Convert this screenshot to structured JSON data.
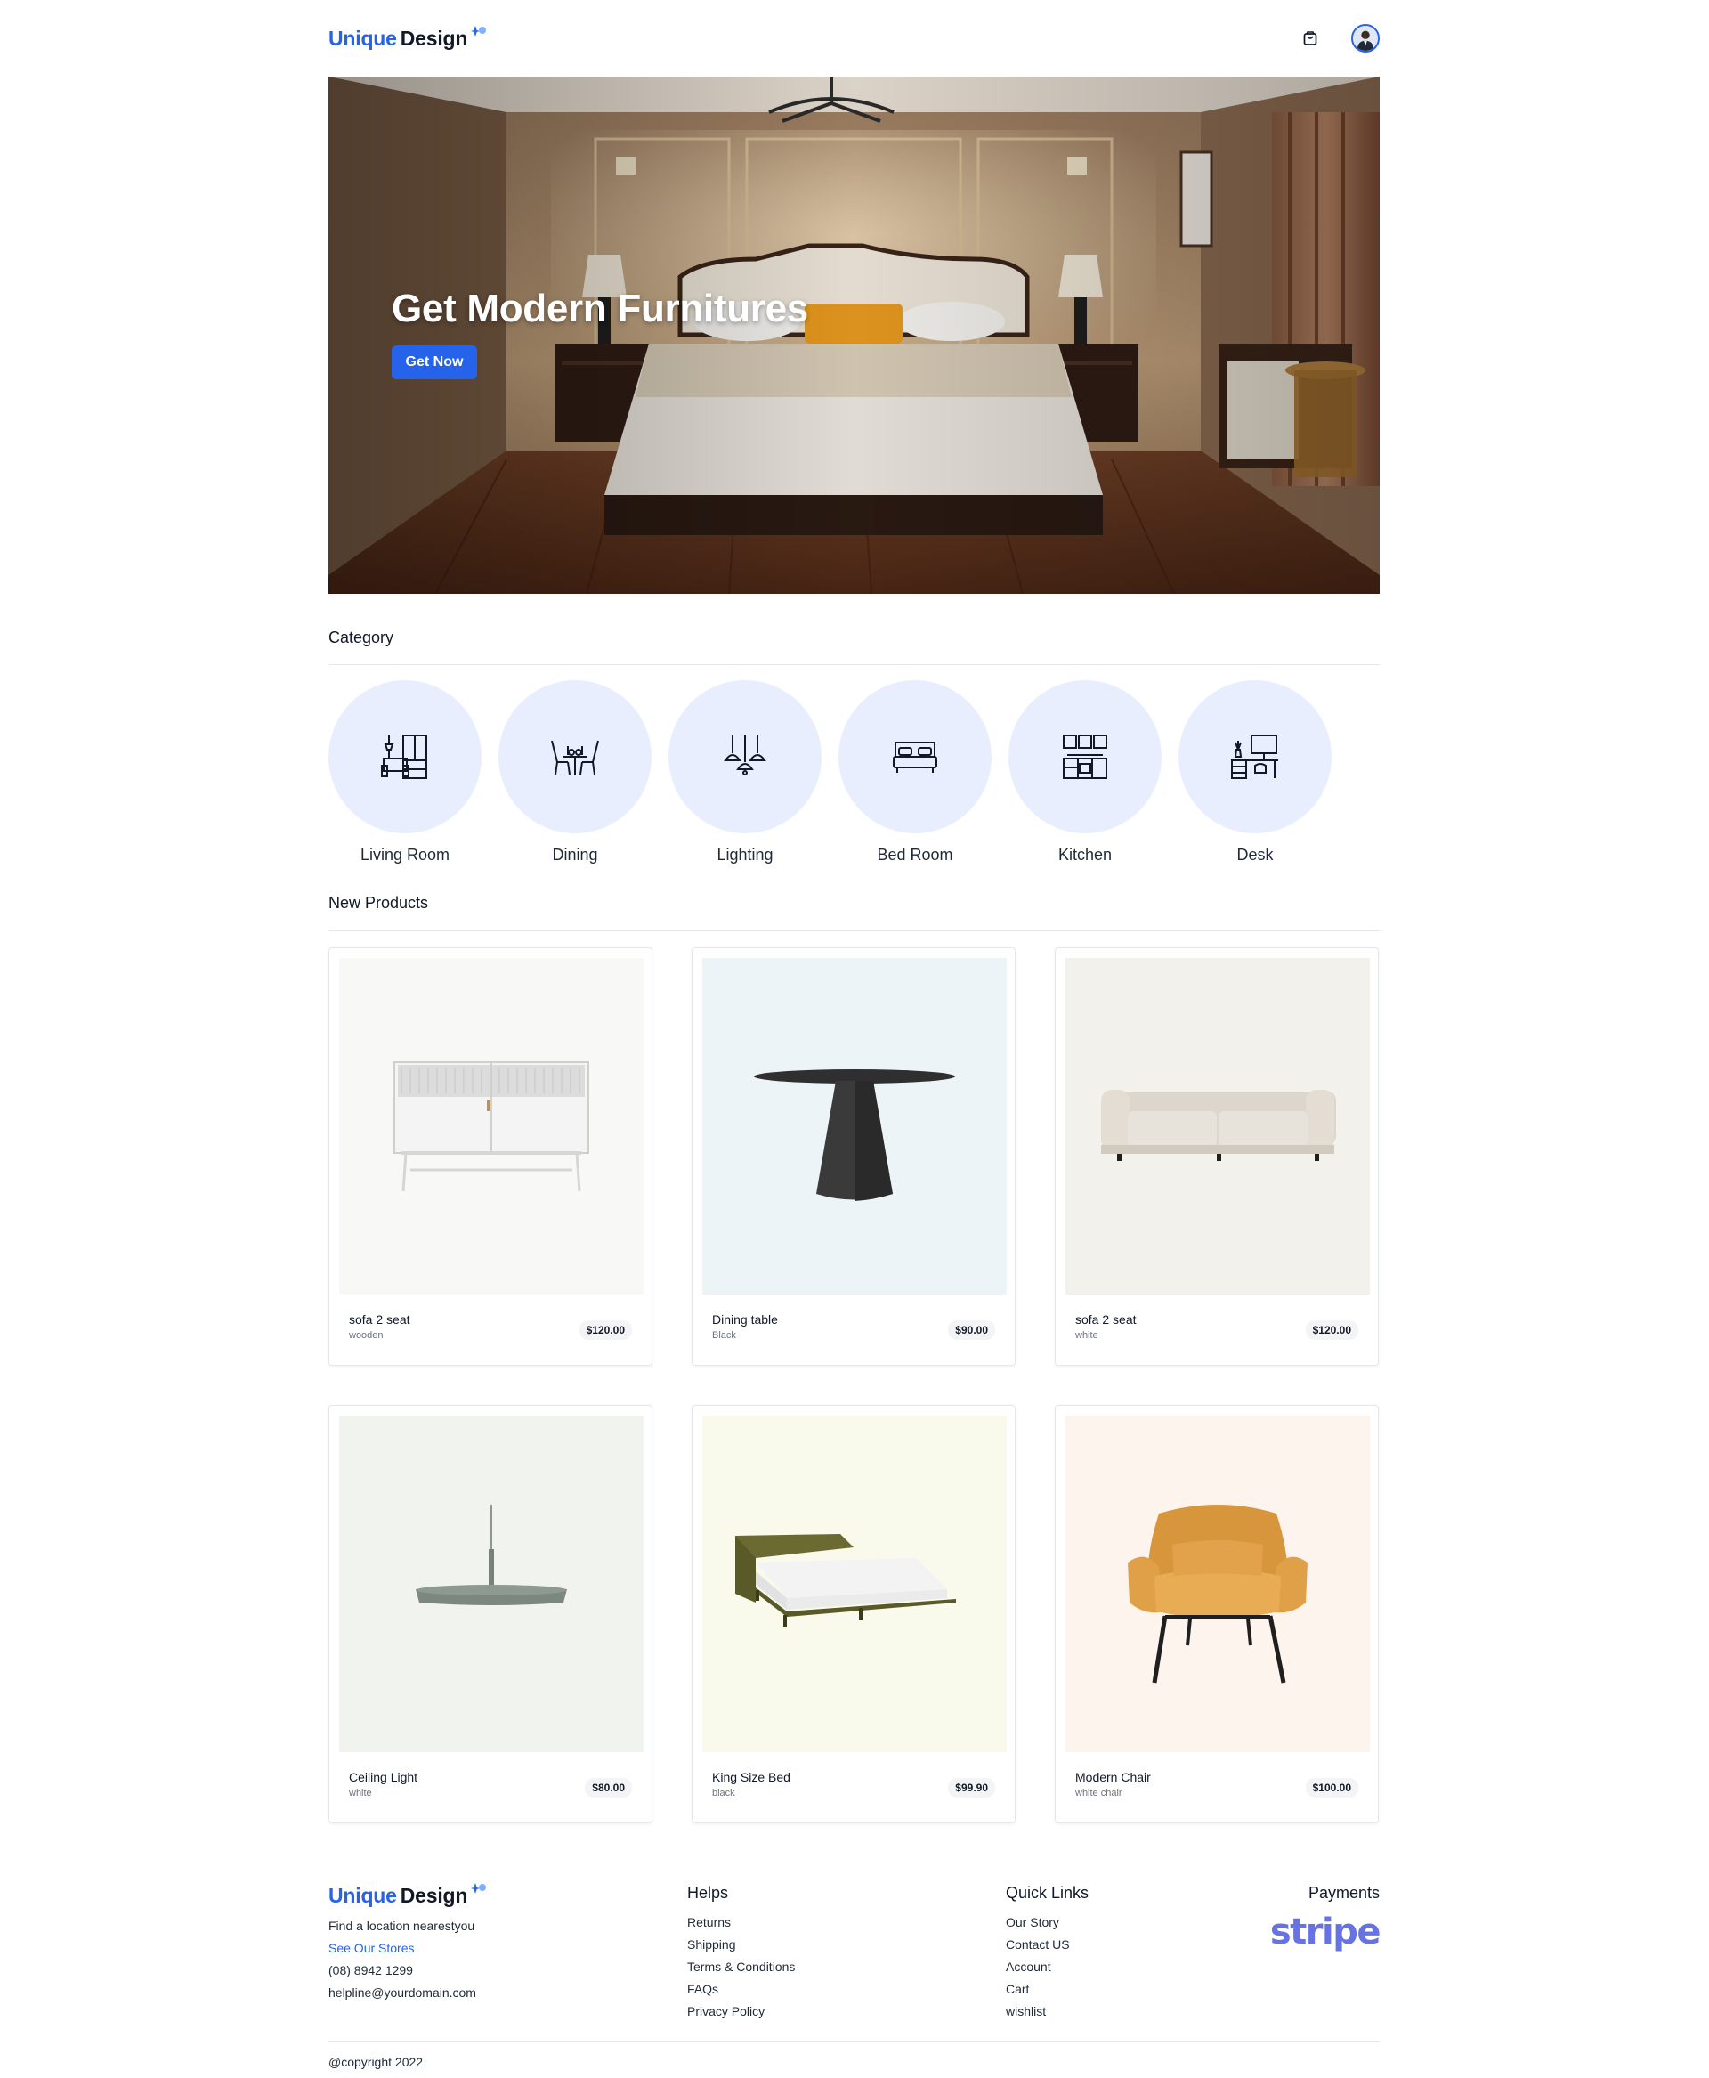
{
  "header": {
    "logo_word1": "Unique",
    "logo_word2": "Design",
    "cart_icon": "shopping-bag-icon",
    "avatar_icon": "user-avatar"
  },
  "hero": {
    "title": "Get Modern Furnitures",
    "button_label": "Get Now"
  },
  "categories": {
    "title": "Category",
    "items": [
      {
        "label": "Living Room",
        "icon": "living-room-icon"
      },
      {
        "label": "Dining",
        "icon": "dining-icon"
      },
      {
        "label": "Lighting",
        "icon": "lighting-icon"
      },
      {
        "label": "Bed Room",
        "icon": "bed-room-icon"
      },
      {
        "label": "Kitchen",
        "icon": "kitchen-icon"
      },
      {
        "label": "Desk",
        "icon": "desk-icon"
      }
    ]
  },
  "products": {
    "title": "New Products",
    "items": [
      {
        "name": "sofa 2 seat",
        "variant": "wooden",
        "price": "$120.00",
        "bg": "#f8f8f7"
      },
      {
        "name": "Dining table",
        "variant": "Black",
        "price": "$90.00",
        "bg": "#ecf4f8"
      },
      {
        "name": "sofa 2 seat",
        "variant": "white",
        "price": "$120.00",
        "bg": "#f2f1ec"
      },
      {
        "name": "Ceiling Light",
        "variant": "white",
        "price": "$80.00",
        "bg": "#f1f3ef"
      },
      {
        "name": "King Size Bed",
        "variant": "black",
        "price": "$99.90",
        "bg": "#f9f9ec"
      },
      {
        "name": "Modern Chair",
        "variant": "white chair",
        "price": "$100.00",
        "bg": "#fdf4ee"
      }
    ]
  },
  "footer": {
    "logo_word1": "Unique",
    "logo_word2": "Design",
    "tagline": "Find a location nearestyou",
    "stores_link": "See Our Stores",
    "phone": "(08) 8942 1299",
    "email": "helpline@yourdomain.com",
    "helps": {
      "title": "Helps",
      "links": [
        "Returns",
        "Shipping",
        "Terms & Conditions",
        "FAQs",
        "Privacy Policy"
      ]
    },
    "quick_links": {
      "title": "Quick Links",
      "links": [
        "Our Story",
        "Contact US",
        "Account",
        "Cart",
        "wishlist"
      ]
    },
    "payments": {
      "title": "Payments",
      "provider": "stripe"
    },
    "copyright": "@copyright 2022"
  },
  "colors": {
    "brand": "#2563eb",
    "category_bg": "#e8eefd",
    "stripe": "#6772e5"
  }
}
